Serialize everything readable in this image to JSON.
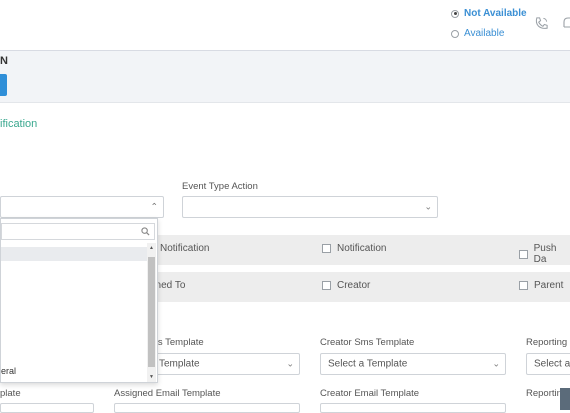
{
  "header": {
    "status_not_available": "Not Available",
    "status_available": "Available",
    "icons": [
      "phone-icon",
      "bell-icon"
    ]
  },
  "subbar": {
    "title_fragment": "N"
  },
  "section": {
    "link_fragment": "ification"
  },
  "form": {
    "event_type_action_label": "Event Type Action",
    "row1": {
      "col1": "Notification",
      "col2": "Notification",
      "col3": "Push Da"
    },
    "row2": {
      "col1": "gned To",
      "col2": "Creator",
      "col3": "Parent"
    },
    "sms": {
      "label1": "ms Template",
      "label2": "Creator Sms Template",
      "label3": "Reporting",
      "select1": "Template",
      "select2": "Select a Template",
      "select3": "Select a"
    },
    "email": {
      "label0": "plate",
      "label1": "Assigned Email Template",
      "label2": "Creator Email Template",
      "label3": "Reportin"
    }
  },
  "dropdown": {
    "last_item": "eral"
  }
}
